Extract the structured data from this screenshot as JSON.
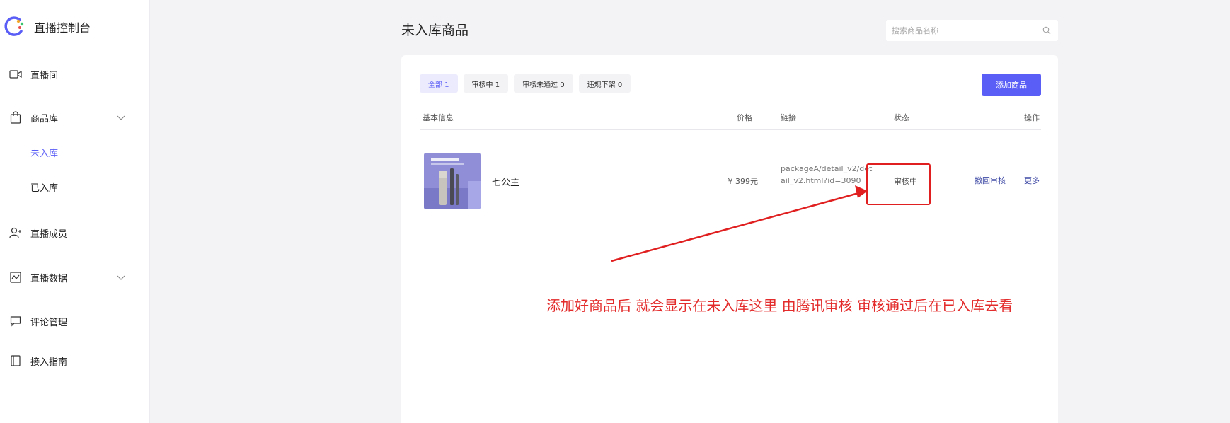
{
  "brand": {
    "title": "直播控制台"
  },
  "sidebar": {
    "items": [
      {
        "label": "直播间",
        "icon": "video-icon"
      },
      {
        "label": "商品库",
        "icon": "shopping-bag-icon",
        "expandable": true
      },
      {
        "label": "直播成员",
        "icon": "user-icon"
      },
      {
        "label": "直播数据",
        "icon": "chart-icon",
        "expandable": true
      },
      {
        "label": "评论管理",
        "icon": "comment-icon"
      },
      {
        "label": "接入指南",
        "icon": "book-icon"
      }
    ],
    "sub_items": [
      {
        "label": "未入库",
        "active": true
      },
      {
        "label": "已入库",
        "active": false
      }
    ]
  },
  "page": {
    "title": "未入库商品"
  },
  "search": {
    "placeholder": "搜索商品名称"
  },
  "tabs": [
    {
      "label": "全部 1",
      "active": true
    },
    {
      "label": "审核中 1",
      "active": false
    },
    {
      "label": "审核未通过 0",
      "active": false
    },
    {
      "label": "违规下架 0",
      "active": false
    }
  ],
  "add_button": {
    "label": "添加商品"
  },
  "table": {
    "headers": {
      "info": "基本信息",
      "price": "价格",
      "link": "链接",
      "status": "状态",
      "ops": "操作"
    },
    "rows": [
      {
        "name": "七公主",
        "price": "¥ 399元",
        "link": "packageA/detail_v2/detail_v2.html?id=3090",
        "status": "审核中",
        "actions": {
          "withdraw": "撤回审核",
          "more": "更多"
        }
      }
    ]
  },
  "annotation": {
    "text": "添加好商品后  就会显示在未入库这里 由腾讯审核  审核通过后在已入库去看",
    "color": "#e32b2b"
  },
  "colors": {
    "accent": "#5b5ef6",
    "link": "#3f4aa5",
    "annotation": "#e02020"
  }
}
